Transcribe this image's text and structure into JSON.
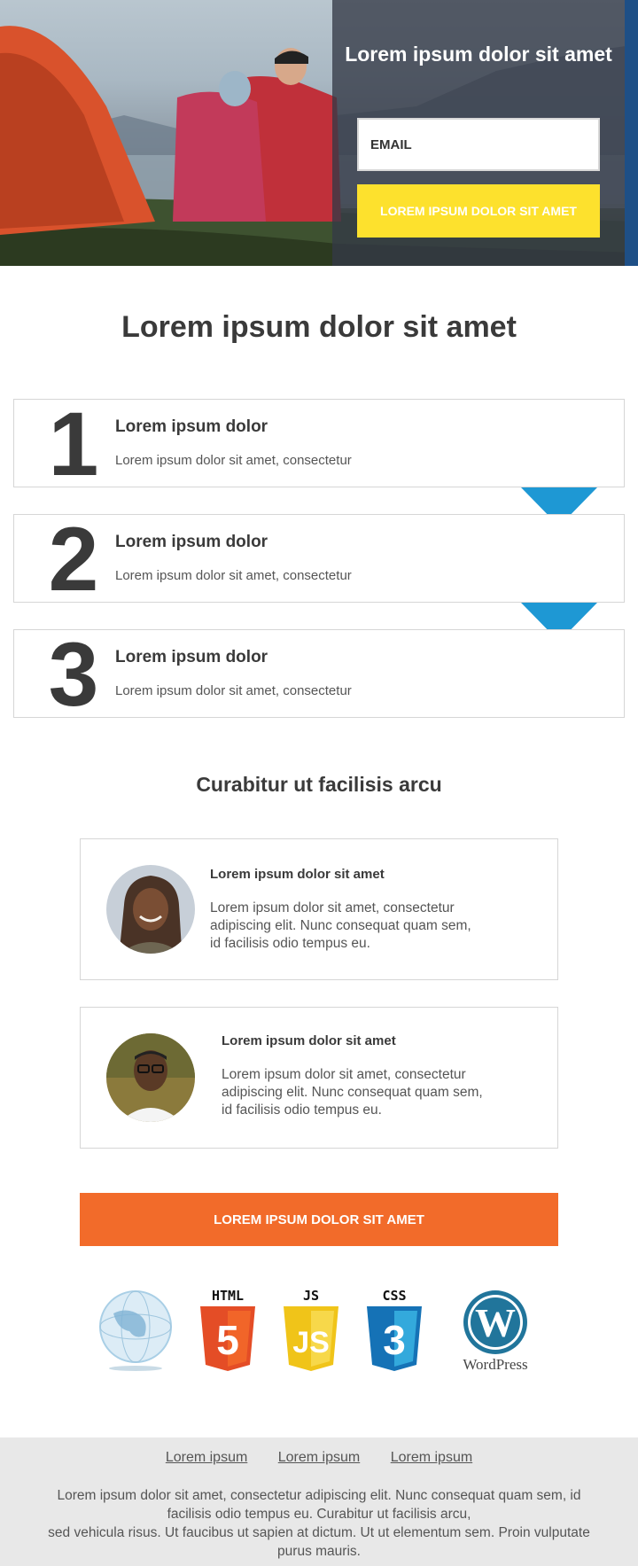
{
  "hero": {
    "title": "Lorem ipsum dolor sit amet",
    "email_placeholder": "EMAIL",
    "button_label": "LOREM IPSUM DOLOR SIT AMET"
  },
  "steps_section": {
    "title": "Lorem ipsum dolor sit amet",
    "steps": [
      {
        "number": "1",
        "title": "Lorem ipsum dolor",
        "text": "Lorem ipsum dolor sit amet, consectetur"
      },
      {
        "number": "2",
        "title": "Lorem ipsum dolor",
        "text": "Lorem ipsum dolor sit amet, consectetur"
      },
      {
        "number": "3",
        "title": "Lorem ipsum dolor",
        "text": "Lorem ipsum dolor sit amet, consectetur"
      }
    ],
    "arrow_color": "#1e98d4"
  },
  "testimonials": {
    "title": "Curabitur ut facilisis arcu",
    "items": [
      {
        "name": "Lorem ipsum dolor sit amet",
        "text": "Lorem ipsum dolor sit amet, consectetur adipiscing elit. Nunc consequat quam sem, id facilisis odio tempus eu."
      },
      {
        "name": "Lorem ipsum dolor sit amet",
        "text": "Lorem ipsum dolor sit amet, consectetur adipiscing elit. Nunc consequat quam sem, id facilisis odio tempus eu."
      }
    ]
  },
  "cta": {
    "label": "LOREM IPSUM DOLOR SIT AMET",
    "color": "#f26b2a"
  },
  "logos": {
    "html_label": "HTML",
    "js_label": "JS",
    "css_label": "CSS",
    "html_digit": "5",
    "js_digit": "JS",
    "css_digit": "3",
    "wordpress_label": "WordPress",
    "icons": [
      "globe-icon",
      "html5-icon",
      "js-icon",
      "css3-icon",
      "wordpress-icon"
    ]
  },
  "footer": {
    "links": [
      "Lorem ipsum",
      "Lorem ipsum",
      "Lorem ipsum"
    ],
    "text_line1": "Lorem ipsum dolor sit amet, consectetur adipiscing elit. Nunc consequat quam sem, id facilisis odio tempus eu. Curabitur ut facilisis arcu,",
    "text_line2": "sed vehicula risus. Ut faucibus ut sapien at dictum. Ut ut elementum sem. Proin vulputate purus mauris."
  },
  "colors": {
    "hero_button": "#fde12d",
    "accent_blue": "#1e98d4",
    "footer_bg": "#e8e8e8"
  }
}
